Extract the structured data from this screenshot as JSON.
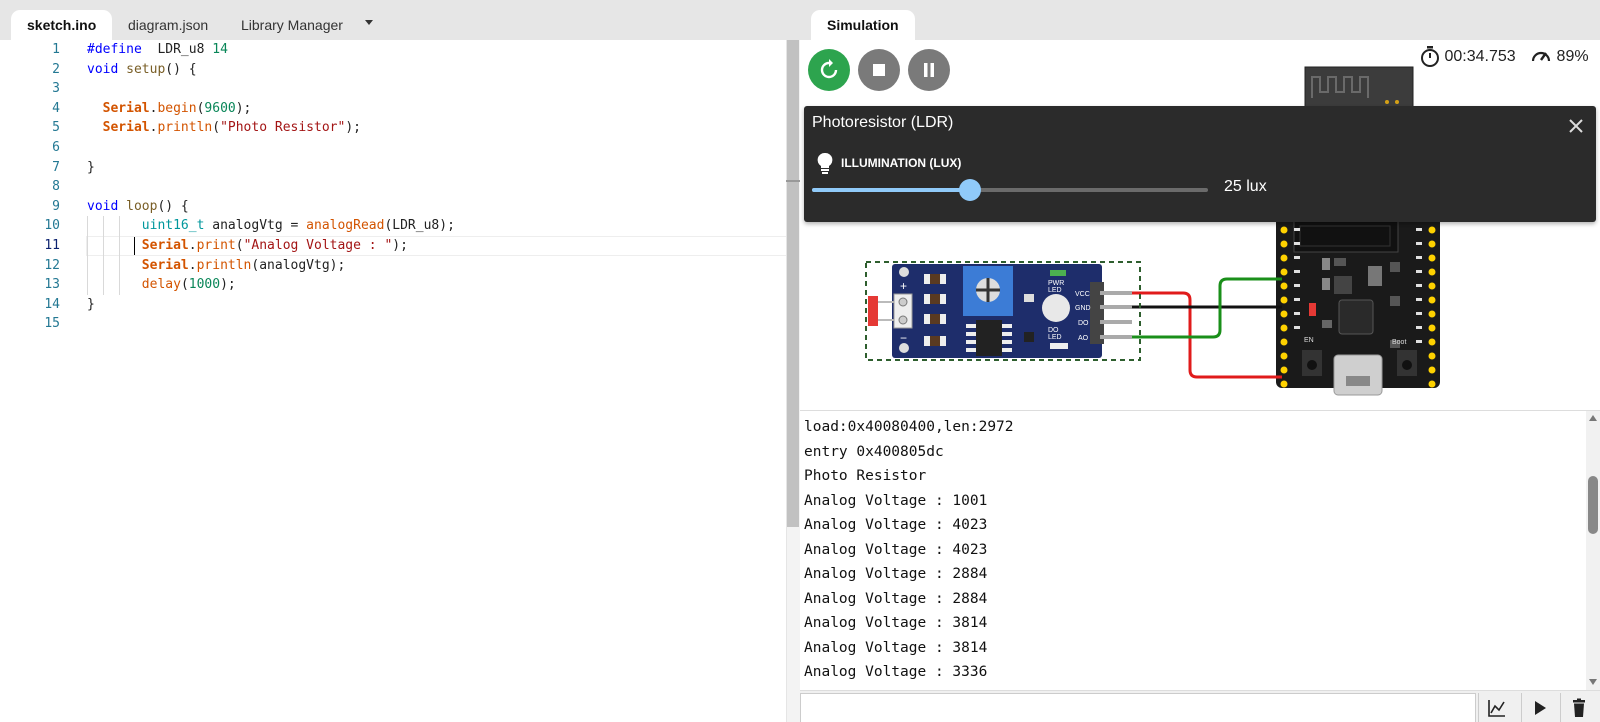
{
  "editor": {
    "tabs": [
      "sketch.ino",
      "diagram.json",
      "Library Manager"
    ],
    "active_tab": "sketch.ino",
    "current_line": 11,
    "lines": [
      {
        "n": "1",
        "text": "#define  LDR_u8 14"
      },
      {
        "n": "2",
        "text": "void setup() {"
      },
      {
        "n": "3",
        "text": ""
      },
      {
        "n": "4",
        "text": "  Serial.begin(9600);"
      },
      {
        "n": "5",
        "text": "  Serial.println(\"Photo Resistor\");"
      },
      {
        "n": "6",
        "text": ""
      },
      {
        "n": "7",
        "text": "}"
      },
      {
        "n": "8",
        "text": ""
      },
      {
        "n": "9",
        "text": "void loop() {"
      },
      {
        "n": "10",
        "text": "      uint16_t analogVtg = analogRead(LDR_u8);"
      },
      {
        "n": "11",
        "text": "      Serial.print(\"Analog Voltage : \");"
      },
      {
        "n": "12",
        "text": "      Serial.println(analogVtg);"
      },
      {
        "n": "13",
        "text": "      delay(1000);"
      },
      {
        "n": "14",
        "text": "}"
      },
      {
        "n": "15",
        "text": ""
      }
    ]
  },
  "simulation": {
    "tab_label": "Simulation",
    "timer": "00:34.753",
    "speed": "89%",
    "colors": {
      "restart": "#2da44e",
      "control": "#7a7a7a",
      "slider": "#90caf9",
      "popup_bg": "#2b2b2b"
    },
    "popup": {
      "title": "Photoresistor (LDR)",
      "field_label": "ILLUMINATION (LUX)",
      "value_text": "25 lux",
      "slider_fraction": 0.4
    },
    "ldr_module": {
      "pin_labels": [
        "VCC",
        "GND",
        "DO",
        "AO"
      ],
      "pwr_led": [
        "PWR",
        "LED"
      ],
      "do_led": [
        "DO",
        "LED"
      ],
      "plus": "+",
      "minus": "−"
    },
    "board": {
      "en_label": "EN",
      "boot_label": "Boot"
    }
  },
  "serial": {
    "lines": [
      "load:0x40080400,len:2972",
      "entry 0x400805dc",
      "Photo Resistor",
      "Analog Voltage : 1001",
      "Analog Voltage : 4023",
      "Analog Voltage : 4023",
      "Analog Voltage : 2884",
      "Analog Voltage : 2884",
      "Analog Voltage : 3814",
      "Analog Voltage : 3814",
      "Analog Voltage : 3336"
    ],
    "input_value": "",
    "icons": [
      "chart-icon",
      "play-icon",
      "trash-icon"
    ]
  }
}
